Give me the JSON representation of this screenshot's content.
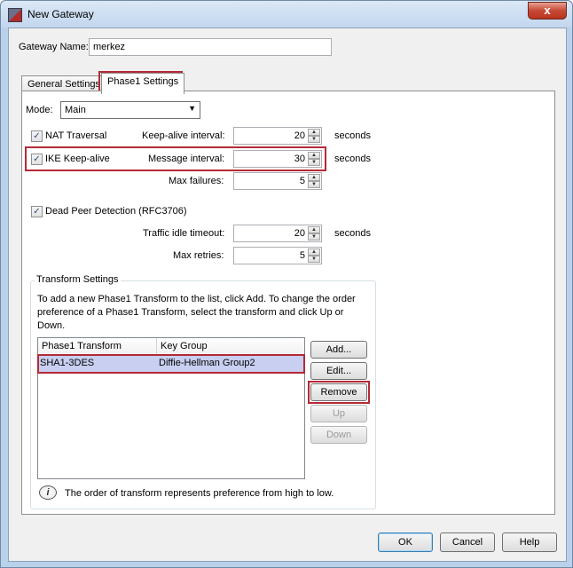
{
  "window": {
    "title": "New Gateway",
    "close_glyph": "x"
  },
  "gateway": {
    "label": "Gateway Name:",
    "value": "merkez"
  },
  "tabs": [
    {
      "label": "General Settings"
    },
    {
      "label": "Phase1 Settings"
    }
  ],
  "mode": {
    "label": "Mode:",
    "value": "Main"
  },
  "nat": {
    "label": "NAT Traversal",
    "interval_label": "Keep-alive interval:",
    "interval_value": "20",
    "unit": "seconds"
  },
  "ike": {
    "label": "IKE Keep-alive",
    "interval_label": "Message interval:",
    "interval_value": "30",
    "unit": "seconds",
    "max_failures_label": "Max failures:",
    "max_failures_value": "5"
  },
  "dpd": {
    "label": "Dead Peer Detection (RFC3706)",
    "idle_label": "Traffic idle timeout:",
    "idle_value": "20",
    "unit": "seconds",
    "retries_label": "Max retries:",
    "retries_value": "5"
  },
  "transform": {
    "group_title": "Transform Settings",
    "description": "To add a new Phase1 Transform to the list, click Add. To change the order preference of a Phase1 Transform, select the transform and click Up or Down.",
    "columns": [
      "Phase1 Transform",
      "Key Group"
    ],
    "rows": [
      {
        "transform": "SHA1-3DES",
        "key_group": "Diffie-Hellman Group2"
      }
    ],
    "buttons": {
      "add": "Add...",
      "edit": "Edit...",
      "remove": "Remove",
      "up": "Up",
      "down": "Down"
    },
    "note": "The order of transform represents preference from high to low."
  },
  "footer": {
    "ok": "OK",
    "cancel": "Cancel",
    "help": "Help"
  },
  "colors": {
    "highlight": "#b42a36",
    "selection": "#c8cff0"
  }
}
